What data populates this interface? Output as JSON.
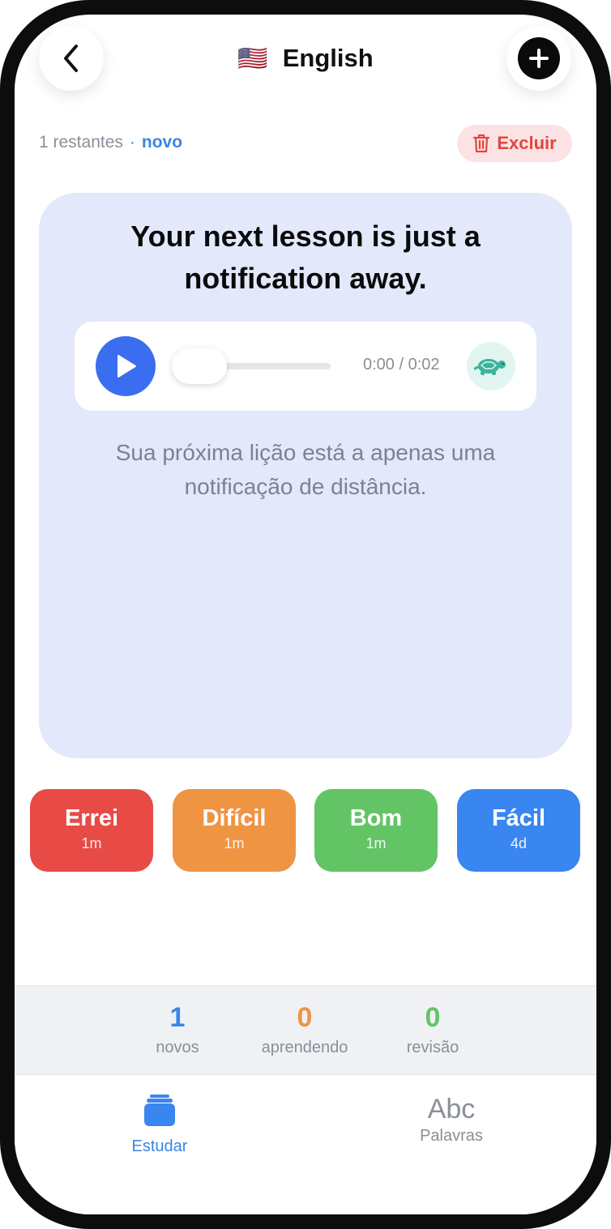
{
  "header": {
    "flag": "🇺🇸",
    "title": "English"
  },
  "meta": {
    "remaining": "1 restantes",
    "separator": "·",
    "status": "novo"
  },
  "delete_label": "Excluir",
  "card": {
    "title": "Your next lesson is just a notification away.",
    "translation": "Sua próxima lição está a apenas uma notificação de distância.",
    "audio": {
      "time": "0:00 / 0:02",
      "progress": 0
    }
  },
  "grades": [
    {
      "label": "Errei",
      "interval": "1m",
      "color": "#e84a45"
    },
    {
      "label": "Difícil",
      "interval": "1m",
      "color": "#ef9443"
    },
    {
      "label": "Bom",
      "interval": "1m",
      "color": "#63c466"
    },
    {
      "label": "Fácil",
      "interval": "4d",
      "color": "#3a86f0"
    }
  ],
  "stats": [
    {
      "value": "1",
      "label": "novos",
      "color": "#3a86e4"
    },
    {
      "value": "0",
      "label": "aprendendo",
      "color": "#ef9443"
    },
    {
      "value": "0",
      "label": "revisão",
      "color": "#63c466"
    }
  ],
  "tabs": [
    {
      "label": "Estudar",
      "icon": "cards-stack-icon",
      "active": true
    },
    {
      "label": "Palavras",
      "icon_text": "Abc",
      "active": false
    }
  ],
  "colors": {
    "accent": "#3a86e4",
    "card_bg": "#e3e9fa",
    "play": "#3a6df0",
    "danger": "#e4453f"
  }
}
